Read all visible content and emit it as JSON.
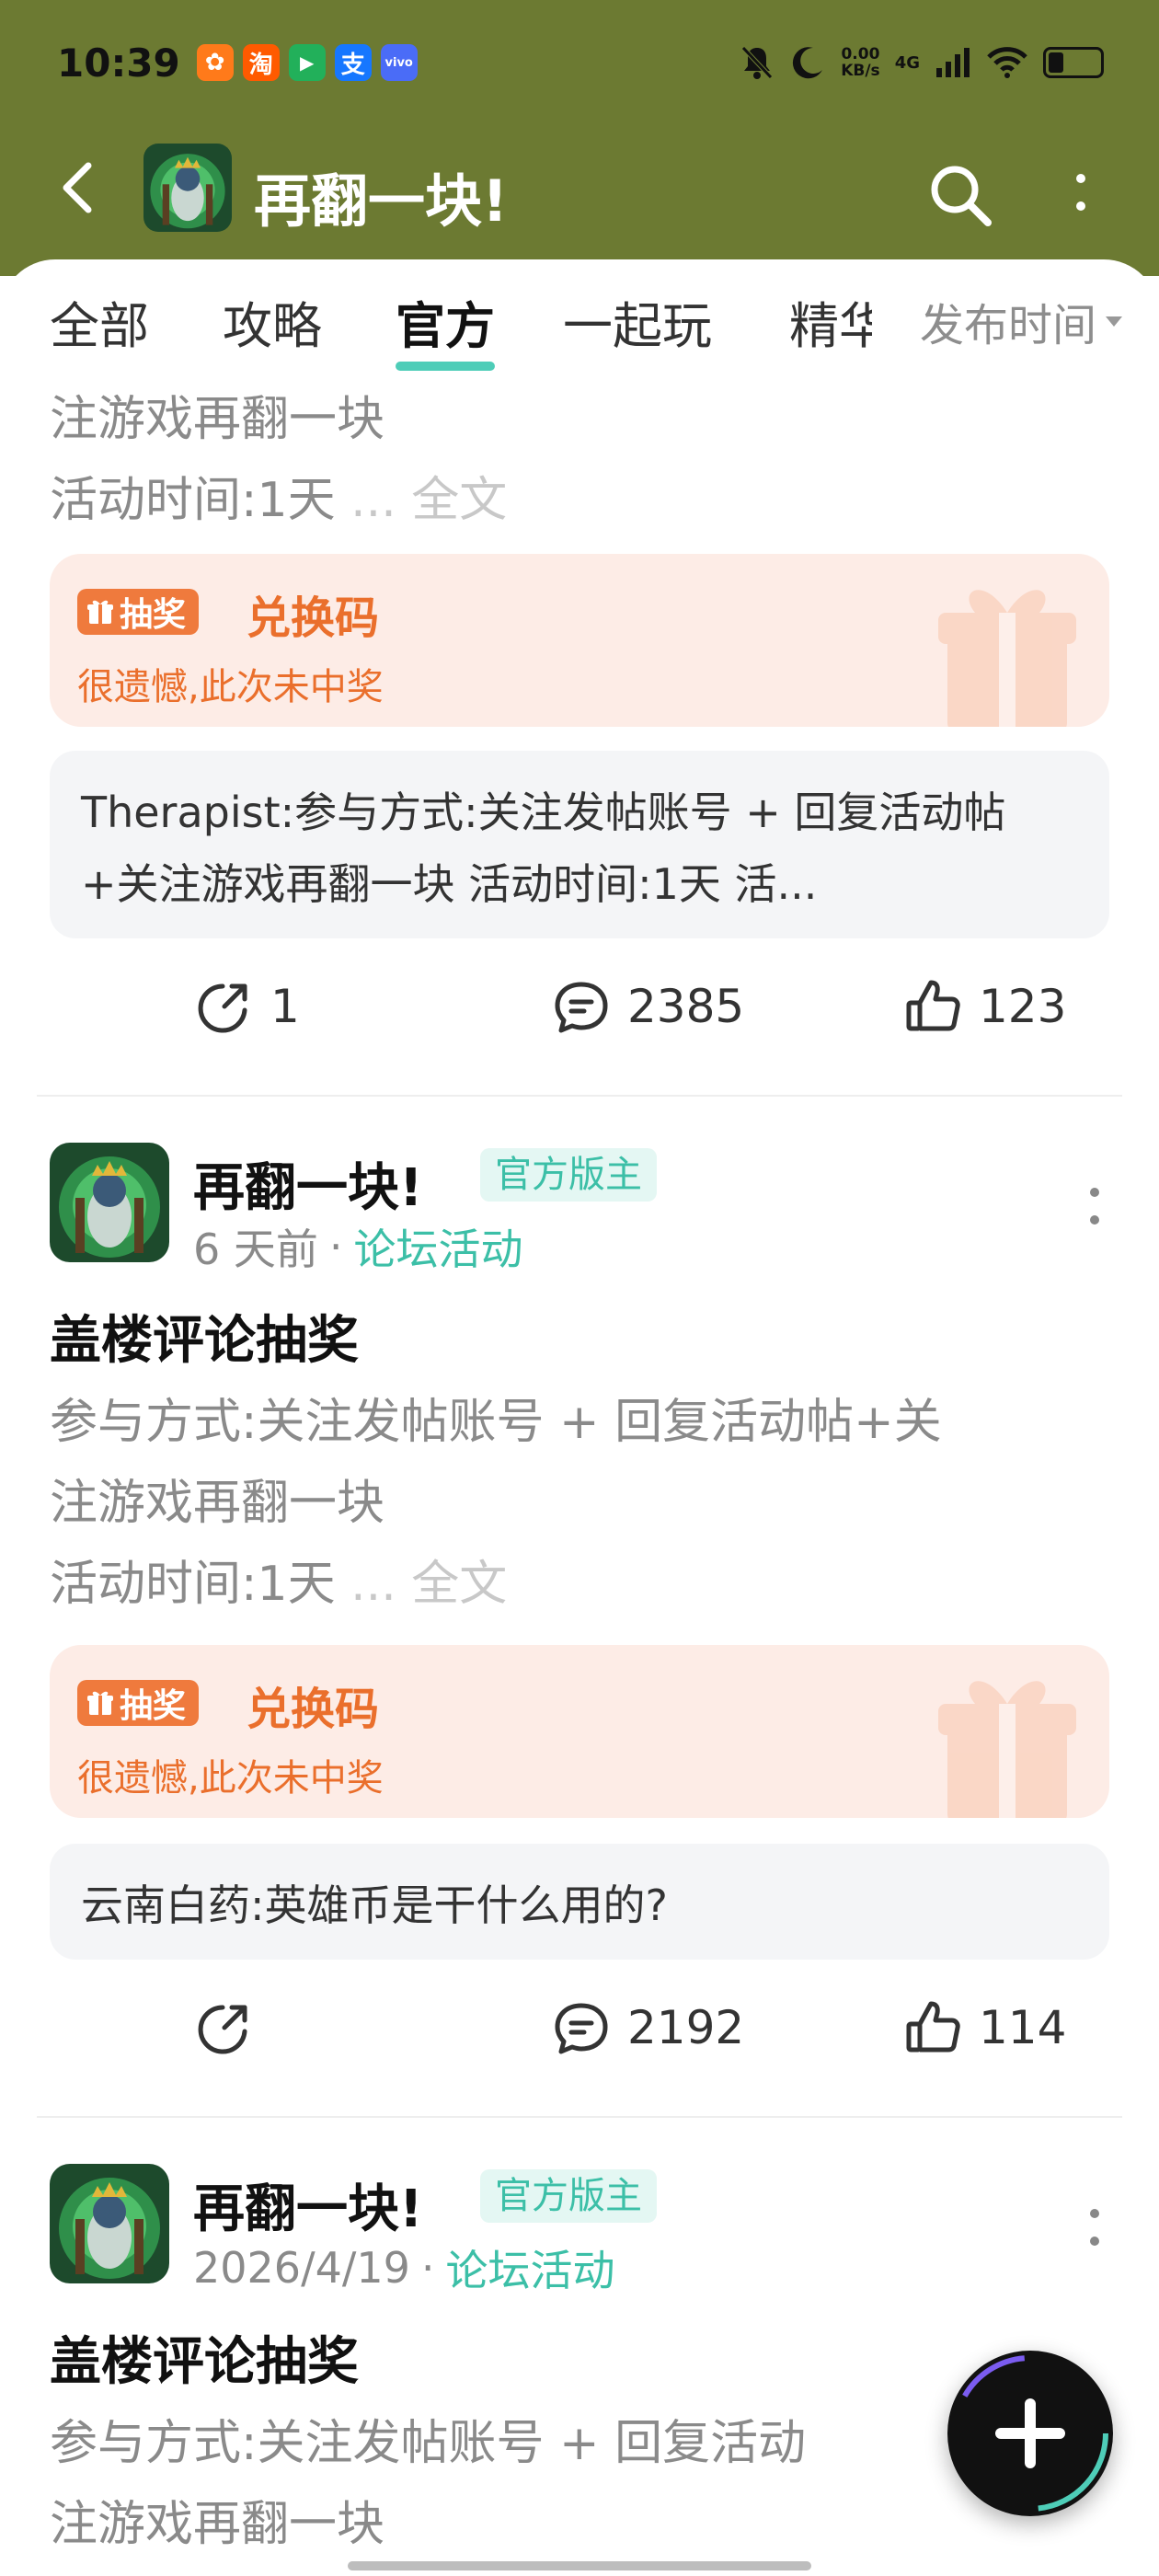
{
  "status": {
    "time": "10:39",
    "apps": [
      {
        "glyph": "✿",
        "color": "#ff7a1a"
      },
      {
        "glyph": "淘",
        "color": "#ff5a00"
      },
      {
        "glyph": "▶",
        "color": "#22b05a"
      },
      {
        "glyph": "支",
        "color": "#1677ff"
      },
      {
        "glyph": "vivo",
        "color": "#4a6cf7"
      }
    ],
    "speed_value": "0.00",
    "speed_unit": "KB/s",
    "network": "4G",
    "battery_level": 0.3
  },
  "header": {
    "title": "再翻一块!",
    "colors": {
      "bar": "#6c7a32",
      "accent": "#4ecdb8"
    }
  },
  "tabs": {
    "items": [
      "全部",
      "攻略",
      "官方",
      "一起玩",
      "精华"
    ],
    "active": "官方",
    "sort": "发布时间"
  },
  "post0": {
    "body_line1": "注游戏再翻一块",
    "body_line2": "活动时间:1天",
    "ellipsis": "...",
    "full_text": "全文",
    "lottery_badge": "抽奖",
    "lottery_title": "兑换码",
    "lottery_result": "很遗憾,此次未中奖",
    "comment": "Therapist:参与方式:关注发帖账号 + 回复活动帖+关注游戏再翻一块   活动时间:1天   活...",
    "share_count": "1",
    "comment_count": "2385",
    "like_count": "123"
  },
  "post1": {
    "author": "再翻一块!",
    "tag": "官方版主",
    "time": "6 天前",
    "dot": "·",
    "category": "论坛活动",
    "title": "盖楼评论抽奖",
    "body_line1": "参与方式:关注发帖账号 + 回复活动帖+关",
    "body_line2": "注游戏再翻一块",
    "body_line3": "活动时间:1天",
    "ellipsis": "...",
    "full_text": "全文",
    "lottery_badge": "抽奖",
    "lottery_title": "兑换码",
    "lottery_result": "很遗憾,此次未中奖",
    "comment": "云南白药:英雄币是干什么用的?",
    "comment_count": "2192",
    "like_count": "114"
  },
  "post2": {
    "author": "再翻一块!",
    "tag": "官方版主",
    "time": "2026/4/19",
    "dot": "·",
    "category": "论坛活动",
    "title": "盖楼评论抽奖",
    "body_line1": "参与方式:关注发帖账号 + 回复活动",
    "body_line2": "注游戏再翻一块"
  }
}
